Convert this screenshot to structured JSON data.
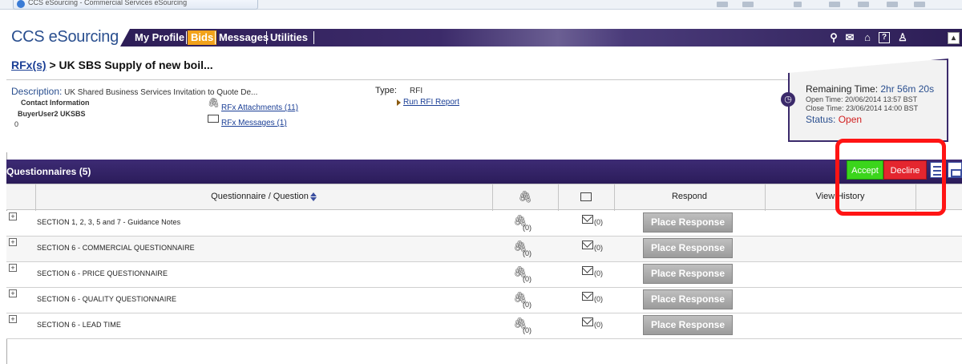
{
  "browser": {
    "tab_title": "CCS eSourcing - Commercial Services eSourcing"
  },
  "header": {
    "brand": "CCS eSourcing",
    "nav": [
      "My Profile",
      "Bids",
      "Messages",
      "Utilities"
    ],
    "active_tab": "Bids",
    "icons": [
      "search-icon",
      "mail-icon",
      "home-icon",
      "help-icon",
      "user-icon",
      "collapse-icon"
    ]
  },
  "breadcrumb": {
    "link": "RFx(s)",
    "sep": " > ",
    "current": "UK SBS Supply of new boil..."
  },
  "info": {
    "description_label": "Description:",
    "description_value": " UK Shared Business Services Invitation to Quote De...",
    "contact_label": "Contact Information",
    "contact_name": "BuyerUser2 UKSBS",
    "contact_extra": "0",
    "type_label": "Type:",
    "type_value": "RFI",
    "attachments_link": "RFx Attachments (11)",
    "messages_link": "RFx Messages (1)",
    "report_link": "Run RFI Report"
  },
  "time_box": {
    "remaining_label": "Remaining Time:",
    "remaining_value": " 2hr 56m 20s",
    "open_time": "Open Time: 20/06/2014 13:57 BST",
    "close_time": "Close Time: 23/06/2014 14:00 BST",
    "status_label": "Status:",
    "status_value": " Open"
  },
  "questionnaires": {
    "title": "Questionnaires (5)",
    "accept_label": "Accept",
    "decline_label": "Decline",
    "columns": {
      "question": "Questionnaire / Question",
      "respond": "Respond",
      "history": "View History"
    },
    "rows": [
      {
        "label": "SECTION 1, 2, 3, 5 and 7 - Guidance Notes",
        "attachments": "(0)",
        "messages": "(0)",
        "action": "Place Response"
      },
      {
        "label": "SECTION 6 - COMMERCIAL QUESTIONNAIRE",
        "attachments": "(0)",
        "messages": "(0)",
        "action": "Place Response"
      },
      {
        "label": "SECTION 6 - PRICE QUESTIONNAIRE",
        "attachments": "(0)",
        "messages": "(0)",
        "action": "Place Response"
      },
      {
        "label": "SECTION 6 - QUALITY QUESTIONNAIRE",
        "attachments": "(0)",
        "messages": "(0)",
        "action": "Place Response"
      },
      {
        "label": "SECTION 6 - LEAD TIME",
        "attachments": "(0)",
        "messages": "(0)",
        "action": "Place Response"
      }
    ]
  },
  "colors": {
    "nav_purple": "#3c2b6a",
    "bids_orange": "#f2a21a",
    "accept_green": "#3bd51c",
    "decline_red": "#e4262f",
    "highlight_red": "#ff1414"
  }
}
